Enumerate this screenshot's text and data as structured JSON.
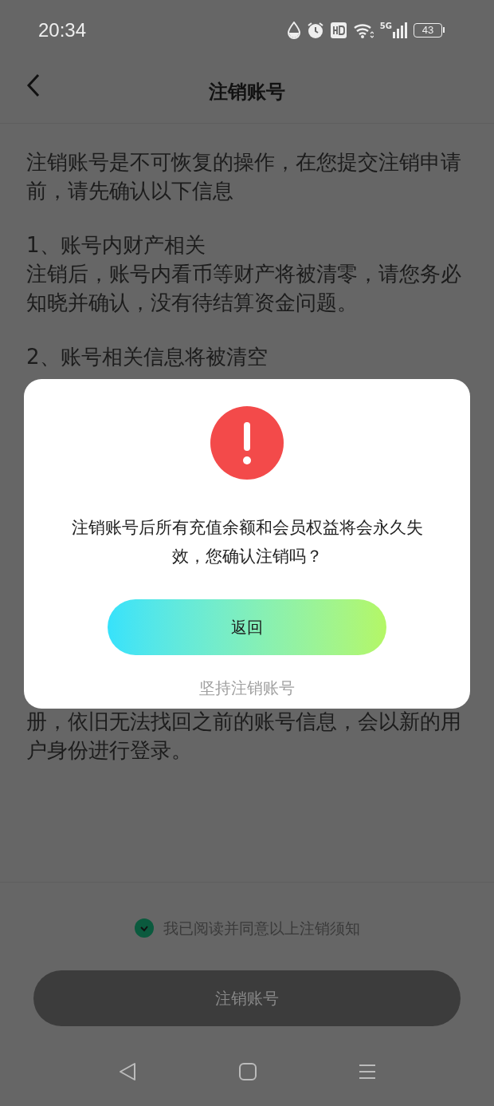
{
  "status_bar": {
    "time": "20:34",
    "network": "5G",
    "battery": "43"
  },
  "header": {
    "title": "注销账号"
  },
  "notice": {
    "intro": "注销账号是不可恢复的操作，在您提交注销申请前，请先确认以下信息",
    "sections": [
      {
        "heading": "1、账号内财产相关",
        "body": "注销后，账号内看币等财产将被清零，请您务必知晓并确认，没有待结算资金问题。"
      },
      {
        "heading": "2、账号相关信息将被清空"
      }
    ],
    "tail": "册，依旧无法找回之前的账号信息，会以新的用户身份进行登录。"
  },
  "agreement": {
    "label": "我已阅读并同意以上注销须知",
    "checked": true
  },
  "submit_button": {
    "label": "注销账号",
    "disabled": true
  },
  "dialog": {
    "message": "注销账号后所有充值余额和会员权益将会永久失效，您确认注销吗？",
    "primary_button": "返回",
    "secondary_button": "坚持注销账号"
  }
}
